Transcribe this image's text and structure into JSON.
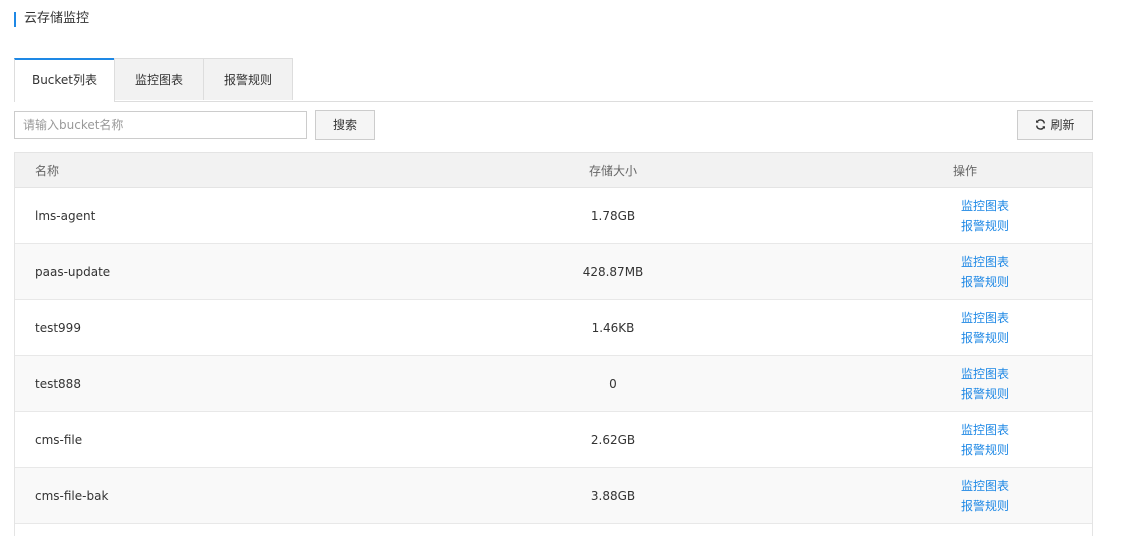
{
  "page": {
    "title": "云存储监控"
  },
  "tabs": [
    {
      "label": "Bucket列表"
    },
    {
      "label": "监控图表"
    },
    {
      "label": "报警规则"
    }
  ],
  "search": {
    "placeholder": "请输入bucket名称",
    "button_label": "搜索"
  },
  "refresh": {
    "label": "刷新",
    "icon": "refresh-icon"
  },
  "table": {
    "headers": {
      "name": "名称",
      "size": "存储大小",
      "op": "操作"
    },
    "rows": [
      {
        "name": "lms-agent",
        "size": "1.78GB",
        "op1": "监控图表",
        "op2": "报警规则"
      },
      {
        "name": "paas-update",
        "size": "428.87MB",
        "op1": "监控图表",
        "op2": "报警规则"
      },
      {
        "name": "test999",
        "size": "1.46KB",
        "op1": "监控图表",
        "op2": "报警规则"
      },
      {
        "name": "test888",
        "size": "0",
        "op1": "监控图表",
        "op2": "报警规则"
      },
      {
        "name": "cms-file",
        "size": "2.62GB",
        "op1": "监控图表",
        "op2": "报警规则"
      },
      {
        "name": "cms-file-bak",
        "size": "3.88GB",
        "op1": "监控图表",
        "op2": "报警规则"
      }
    ]
  },
  "colors": {
    "accent": "#1e88e5",
    "header_bg": "#f2f2f2",
    "border": "#e4e4e4"
  }
}
